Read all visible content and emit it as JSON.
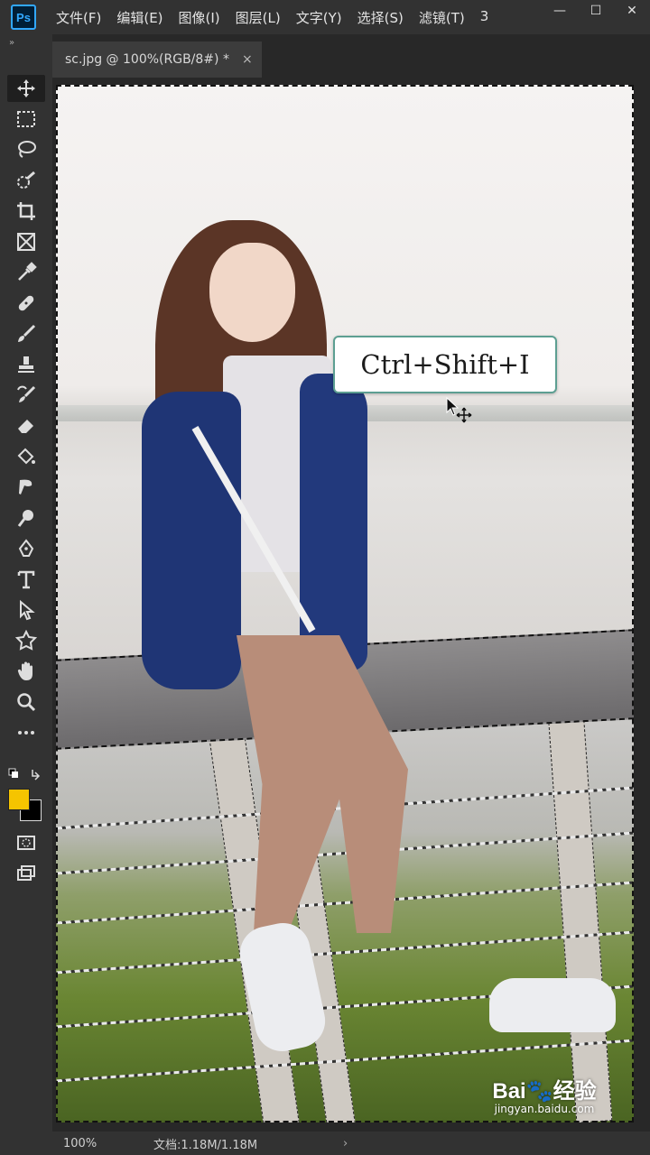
{
  "app": {
    "logo_text": "Ps",
    "menu": [
      "文件(F)",
      "编辑(E)",
      "图像(I)",
      "图层(L)",
      "文字(Y)",
      "选择(S)",
      "滤镜(T)",
      "3"
    ],
    "window_controls": {
      "minimize": "—",
      "maximize": "☐",
      "close": "✕"
    }
  },
  "toolbar": {
    "grip": "»",
    "tools": [
      {
        "name": "move-tool",
        "icon": "move-icon"
      },
      {
        "name": "marquee-tool",
        "icon": "marquee-icon"
      },
      {
        "name": "lasso-tool",
        "icon": "lasso-icon"
      },
      {
        "name": "quick-selection-tool",
        "icon": "quick-selection-icon"
      },
      {
        "name": "crop-tool",
        "icon": "crop-icon"
      },
      {
        "name": "frame-tool",
        "icon": "frame-icon"
      },
      {
        "name": "eyedropper-tool",
        "icon": "eyedropper-icon"
      },
      {
        "name": "healing-brush-tool",
        "icon": "bandage-icon"
      },
      {
        "name": "brush-tool",
        "icon": "brush-icon"
      },
      {
        "name": "clone-stamp-tool",
        "icon": "stamp-icon"
      },
      {
        "name": "history-brush-tool",
        "icon": "history-brush-icon"
      },
      {
        "name": "eraser-tool",
        "icon": "eraser-icon"
      },
      {
        "name": "paint-bucket-tool",
        "icon": "bucket-icon"
      },
      {
        "name": "smudge-tool",
        "icon": "smudge-icon"
      },
      {
        "name": "dodge-tool",
        "icon": "dodge-icon"
      },
      {
        "name": "pen-tool",
        "icon": "pen-icon"
      },
      {
        "name": "type-tool",
        "icon": "type-icon"
      },
      {
        "name": "path-selection-tool",
        "icon": "arrow-icon"
      },
      {
        "name": "shape-tool",
        "icon": "shape-icon"
      },
      {
        "name": "hand-tool",
        "icon": "hand-icon"
      },
      {
        "name": "zoom-tool",
        "icon": "zoom-icon"
      },
      {
        "name": "more-tools",
        "icon": "more-icon"
      }
    ],
    "foreground_color": "#f5c400",
    "background_color": "#000000"
  },
  "document": {
    "tab_title": "sc.jpg @ 100%(RGB/8#) *",
    "tab_close": "×"
  },
  "overlay": {
    "shortcut": "Ctrl+Shift+I"
  },
  "status": {
    "zoom": "100%",
    "doc_info": "文档:1.18M/1.18M",
    "arrow": "›"
  },
  "watermark": {
    "logo": "Bai🐾经验",
    "url": "jingyan.baidu.com"
  }
}
